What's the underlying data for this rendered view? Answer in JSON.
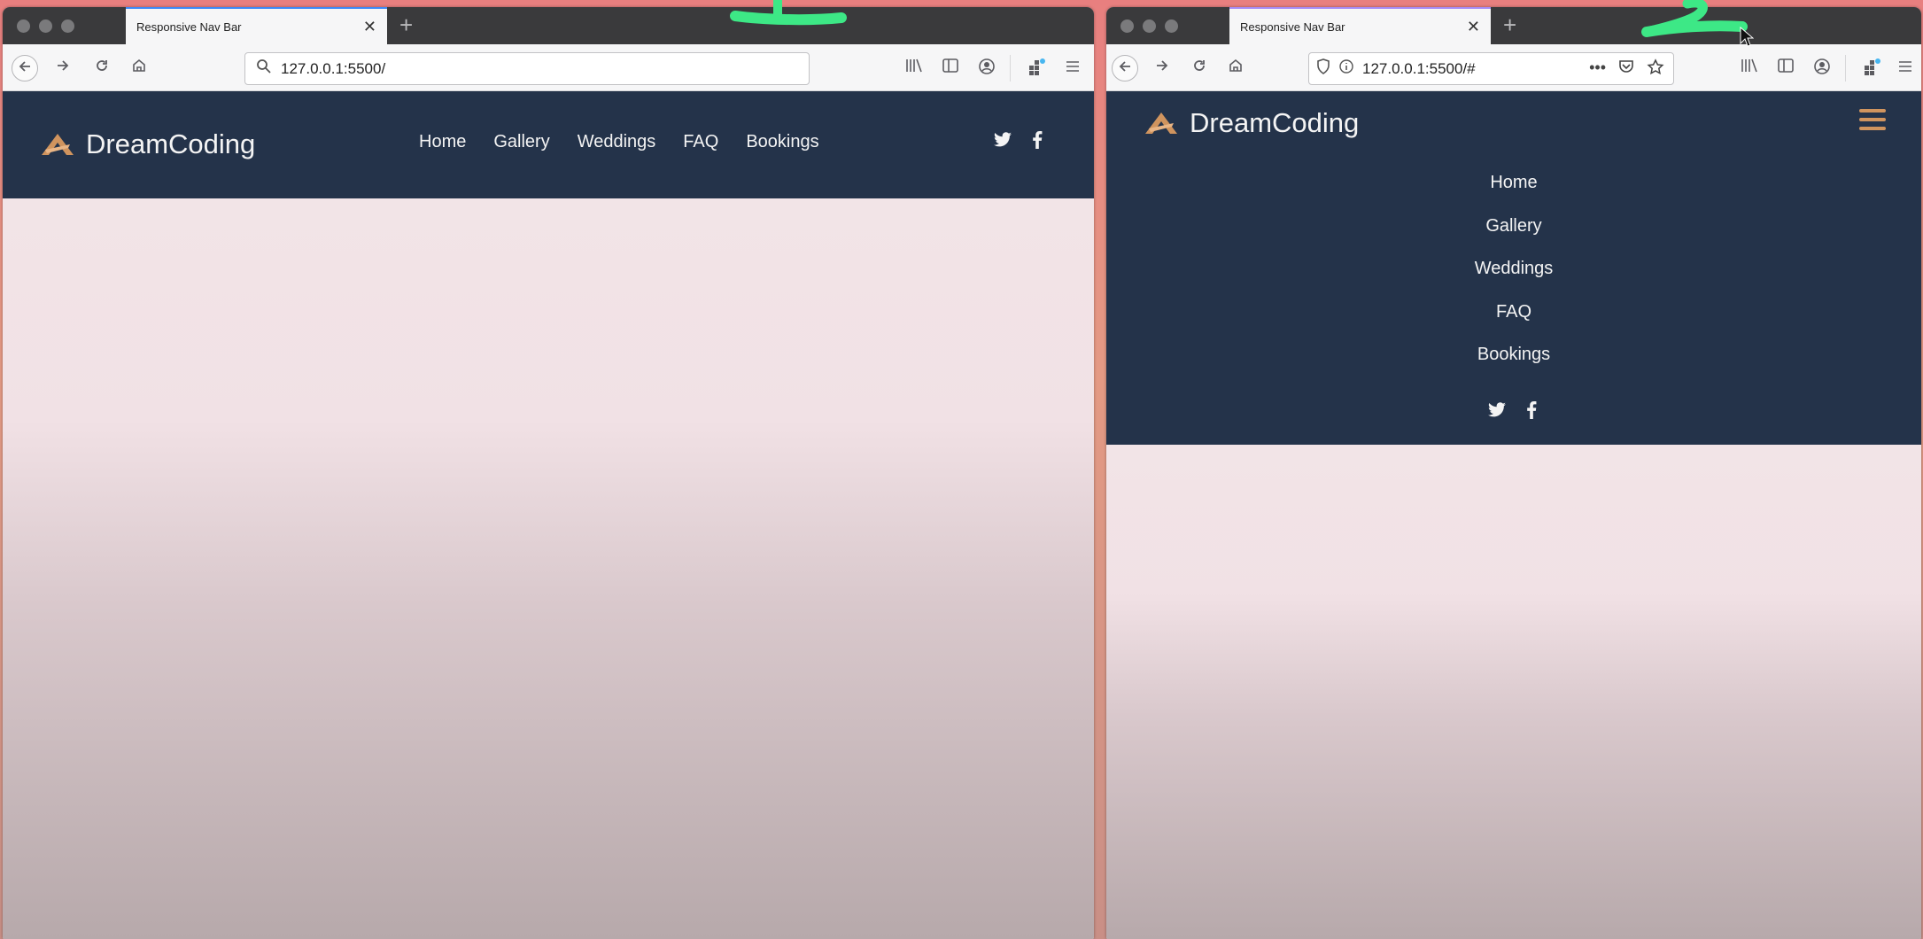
{
  "windows": [
    {
      "tab_title": "Responsive Nav Bar",
      "tab_close": "✕",
      "new_tab": "+",
      "url": "127.0.0.1:5500/",
      "brand": "DreamCoding",
      "menu": [
        "Home",
        "Gallery",
        "Weddings",
        "FAQ",
        "Bookings"
      ],
      "social": [
        "twitter-icon",
        "facebook-icon"
      ],
      "annotation": "1"
    },
    {
      "tab_title": "Responsive Nav Bar",
      "tab_close": "✕",
      "new_tab": "+",
      "url": "127.0.0.1:5500/#",
      "url_dots": "•••",
      "brand": "DreamCoding",
      "menu": [
        "Home",
        "Gallery",
        "Weddings",
        "FAQ",
        "Bookings"
      ],
      "social": [
        "twitter-icon",
        "facebook-icon"
      ],
      "annotation": "2"
    }
  ],
  "colors": {
    "nav_bg": "#24334a",
    "accent": "#d0945e",
    "annotation": "#3de886"
  }
}
